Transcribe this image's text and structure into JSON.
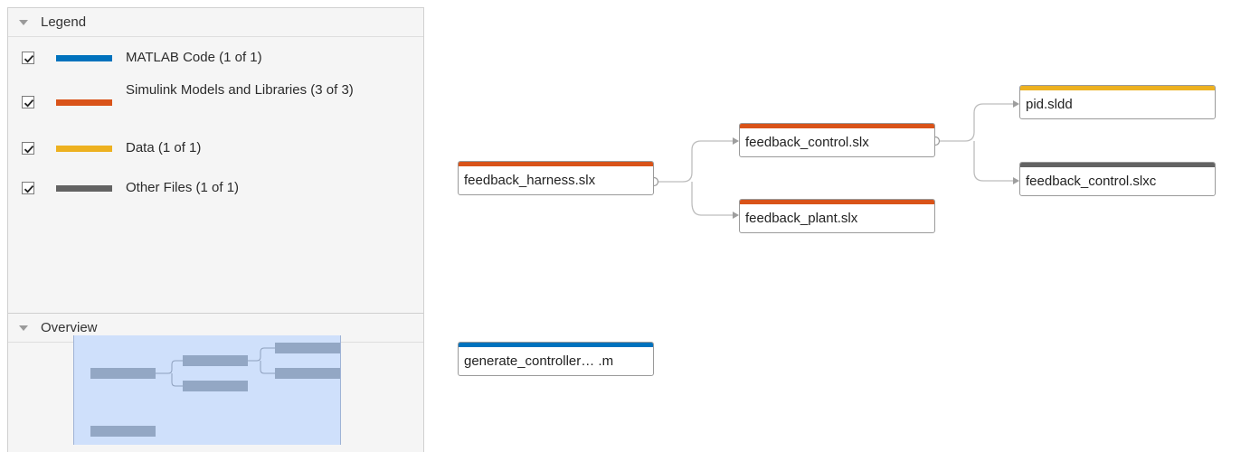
{
  "legend": {
    "title": "Legend",
    "items": [
      {
        "label": "MATLAB Code (1 of 1)",
        "color": "#0072bd",
        "checked": true
      },
      {
        "label": "Simulink Models and Libraries (3 of 3)",
        "color": "#d95319",
        "checked": true
      },
      {
        "label": "Data (1 of 1)",
        "color": "#edb120",
        "checked": true
      },
      {
        "label": "Other Files (1 of 1)",
        "color": "#636363",
        "checked": true
      }
    ]
  },
  "overview": {
    "title": "Overview"
  },
  "nodes": {
    "harness": {
      "label": "feedback_harness.slx",
      "color": "#d95319"
    },
    "control": {
      "label": "feedback_control.slx",
      "color": "#d95319"
    },
    "plant": {
      "label": "feedback_plant.slx",
      "color": "#d95319"
    },
    "sldd": {
      "label": "pid.sldd",
      "color": "#edb120"
    },
    "slxc": {
      "label": "feedback_control.slxc",
      "color": "#636363"
    },
    "generate": {
      "label": "generate_controller… .m",
      "color": "#0072bd"
    }
  },
  "icons": {
    "checkbox": "check-icon",
    "collapse": "triangle-down-icon"
  }
}
